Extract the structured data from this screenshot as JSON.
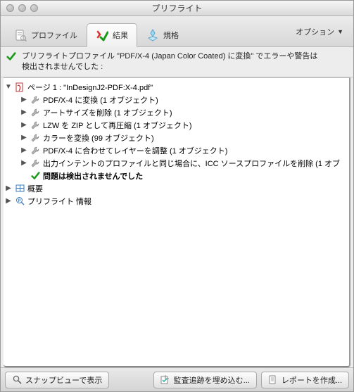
{
  "window": {
    "title": "プリフライト"
  },
  "tabs": {
    "profile": "プロファイル",
    "results": "結果",
    "standards": "規格",
    "options": "オプション"
  },
  "message": {
    "line1": "プリフライトプロファイル \"PDF/X-4 (Japan Color Coated) に変換\" でエラーや警告は",
    "line2": "検出されませんでした :"
  },
  "tree": {
    "page_label": "ページ 1 : \"InDesignJ2-PDF:X-4.pdf\"",
    "items": [
      "PDF/X-4 に変換 (1 オブジェクト)",
      "アートサイズを削除 (1 オブジェクト)",
      "LZW を ZIP として再圧縮 (1 オブジェクト)",
      "カラーを変換 (99 オブジェクト)",
      "PDF/X-4 に合わせてレイヤーを調整 (1 オブジェクト)",
      "出力インテントのプロファイルと同じ場合に、ICC ソースプロファイルを削除 (1 オブ"
    ],
    "no_problems": "問題は検出されませんでした",
    "overview": "概要",
    "preflight_info": "プリフライト 情報"
  },
  "footer": {
    "snap_view": "スナップビューで表示",
    "embed_audit": "監査追跡を埋め込む...",
    "create_report": "レポートを作成..."
  }
}
